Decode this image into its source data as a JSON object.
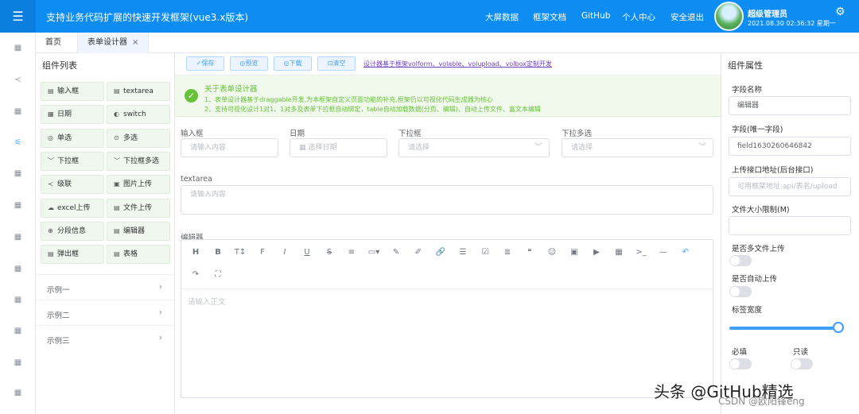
{
  "header": {
    "menu_icon": "menu-icon",
    "title": "支持业务代码扩展的快速开发框架(vue3.x版本)",
    "nav": [
      "大屏数据",
      "框架文档",
      "GitHub",
      "个人中心",
      "安全退出"
    ],
    "user_name": "超级管理员",
    "user_time": "2021.08.30 02:36:32 星期一",
    "settings_icon": "gear-icon",
    "brand_color": "#0d8df2"
  },
  "left_rail": {
    "icons": [
      "grid-icon",
      "share-icon",
      "grid-icon",
      "sliders-icon",
      "grid-icon",
      "grid-icon",
      "grid-icon",
      "grid-icon",
      "grid-icon",
      "grid-icon",
      "grid-icon",
      "grid-icon"
    ]
  },
  "tabs": {
    "home": "首页",
    "designer": "表单设计器",
    "close": "×"
  },
  "components": {
    "title": "组件列表",
    "items": [
      {
        "icon": "text-icon",
        "label": "输入框"
      },
      {
        "icon": "textarea-icon",
        "label": "textarea"
      },
      {
        "icon": "date-icon",
        "label": "日期"
      },
      {
        "icon": "switch-icon",
        "label": "switch"
      },
      {
        "icon": "radio-icon",
        "label": "单选"
      },
      {
        "icon": "check-icon",
        "label": "多选"
      },
      {
        "icon": "chevron-down-icon",
        "label": "下拉框"
      },
      {
        "icon": "chevron-down-icon",
        "label": "下拉框多选"
      },
      {
        "icon": "share-icon",
        "label": "级联"
      },
      {
        "icon": "image-icon",
        "label": "图片上传"
      },
      {
        "icon": "cloud-icon",
        "label": "excel上传"
      },
      {
        "icon": "file-icon",
        "label": "文件上传"
      },
      {
        "icon": "split-icon",
        "label": "分段信息"
      },
      {
        "icon": "editor-icon",
        "label": "编辑器"
      },
      {
        "icon": "popup-icon",
        "label": "弹出框"
      },
      {
        "icon": "table-icon",
        "label": "表格"
      }
    ],
    "samples": [
      "示例一",
      "示例二",
      "示例三"
    ]
  },
  "toolbar": {
    "save": "✓保存",
    "preview": "◎预览",
    "download": "◎下载",
    "clear": "⊡清空",
    "link": "设计器基于框架volform、volable、volupload、volbox定制开发"
  },
  "info": {
    "title": "关于表单设计器",
    "line1": "1、表单设计器基于draggable开发,为本框架自定义页面功能的补充,框架仍以可视化代码生成器为核心",
    "line2": "2、支持可视化设计1对1、1对多及表单下拉框自动绑定，table自动加载数据(分页、编辑)、自动上传文件、富文本编辑"
  },
  "form": {
    "input_label": "输入框",
    "input_placeholder": "请输入内容",
    "date_label": "日期",
    "date_placeholder": "选择日期",
    "select_label": "下拉框",
    "select_placeholder": "请选择",
    "multi_label": "下拉多选",
    "multi_placeholder": "请选择",
    "textarea_label": "textarea",
    "textarea_placeholder": "请输入内容",
    "editor_label": "编辑器",
    "editor_placeholder": "请输入正文"
  },
  "editor_tools": [
    "H",
    "B",
    "T↕",
    "F",
    "I",
    "U",
    "S",
    "≡",
    "▭▾",
    "✎",
    "✐",
    "🔗",
    "☰",
    "☑",
    "≣",
    "❝",
    "☺",
    "▣",
    "▶",
    "▦",
    ">_",
    "—",
    "↶",
    "↷",
    "⛶"
  ],
  "props": {
    "title": "组件属性",
    "field_name_label": "字段名称",
    "field_name_value": "编辑器",
    "field_id_label": "字段(唯一字段)",
    "field_id_value": "field1630260646842",
    "upload_url_label": "上传接口地址(后台接口)",
    "upload_url_placeholder": "可用框架地址:api/表名/upload",
    "file_size_label": "文件大小限制(M)",
    "file_size_value": "",
    "multi_upload_label": "是否多文件上传",
    "auto_upload_label": "是否自动上传",
    "label_width_label": "标签宽度",
    "label_width_value": 1,
    "required_label": "必填",
    "readonly_label": "只读"
  },
  "watermark": {
    "main": "头条 @GitHub精选",
    "sub": "CSDN @欧阳锋eng"
  }
}
